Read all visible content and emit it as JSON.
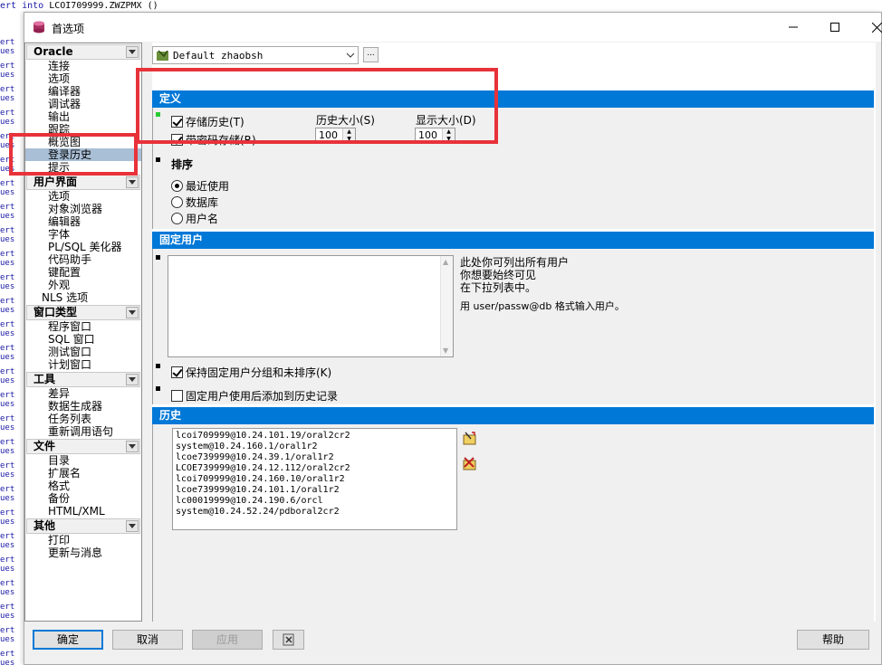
{
  "background": {
    "code_line_prefix": "ert",
    "code_line_keyword": "into",
    "code_line_text": "LCOI709999.ZWZPMX ()",
    "gutter_words": [
      "ert",
      "ues"
    ]
  },
  "window": {
    "title": "首选项",
    "controls": {
      "minimize": "—",
      "maximize": "☐",
      "close": "✕"
    }
  },
  "nav": {
    "groups": [
      {
        "label": "Oracle",
        "items": [
          "连接",
          "选项",
          "编译器",
          "调试器",
          "输出",
          "跟踪",
          "概览图",
          "登录历史",
          "提示"
        ],
        "selected": "登录历史"
      },
      {
        "label": "用户界面",
        "items": [
          "选项",
          "对象浏览器",
          "编辑器",
          "字体",
          "PL/SQL 美化器",
          "代码助手",
          "键配置",
          "外观",
          "NLS 选项"
        ]
      },
      {
        "label": "窗口类型",
        "items": [
          "程序窗口",
          "SQL 窗口",
          "测试窗口",
          "计划窗口"
        ]
      },
      {
        "label": "工具",
        "items": [
          "差异",
          "数据生成器",
          "任务列表",
          "重新调用语句"
        ]
      },
      {
        "label": "文件",
        "items": [
          "目录",
          "扩展名",
          "格式",
          "备份",
          "HTML/XML"
        ]
      },
      {
        "label": "其他",
        "items": [
          "打印",
          "更新与消息"
        ]
      }
    ]
  },
  "profile": {
    "value": "Default zhaobsh",
    "more_label": "..."
  },
  "definition": {
    "header": "定义",
    "store_history": {
      "label": "存储历史(T)",
      "checked": true
    },
    "store_with_password": {
      "label": "带密码存储(R)",
      "checked": true
    },
    "history_size": {
      "label": "历史大小(S)",
      "value": "100"
    },
    "display_size": {
      "label": "显示大小(D)",
      "value": "100"
    }
  },
  "sort": {
    "header": "排序",
    "options": [
      "最近使用",
      "数据库",
      "用户名"
    ],
    "selected": "最近使用"
  },
  "fixed_users": {
    "header": "固定用户",
    "help_lines": [
      "此处你可列出所有用户",
      "你想要始终可见",
      "在下拉列表中。"
    ],
    "help_format": "用 user/passw@db 格式输入用户。",
    "keep_grouped": {
      "label": "保持固定用户分组和未排序(K)",
      "checked": true
    },
    "add_to_history": {
      "label": "固定用户使用后添加到历史记录",
      "checked": false
    }
  },
  "history": {
    "header": "历史",
    "entries": [
      "lcoi709999@10.24.101.19/oral2cr2",
      "system@10.24.160.1/oral1r2",
      "lcoe739999@10.24.39.1/oral1r2",
      "LCOE739999@10.24.12.112/oral2cr2",
      "lcoi709999@10.24.160.10/oral1r2",
      "lcoe739999@10.24.101.1/oral1r2",
      "lc00019999@10.24.190.6/orcl",
      "system@10.24.52.24/pdboral2cr2"
    ]
  },
  "buttons": {
    "ok": "确定",
    "cancel": "取消",
    "apply": "应用",
    "help": "帮助"
  },
  "colors": {
    "section_header": "#0078d7",
    "annotation": "#e8323a",
    "selection": "#a9bfd6"
  }
}
